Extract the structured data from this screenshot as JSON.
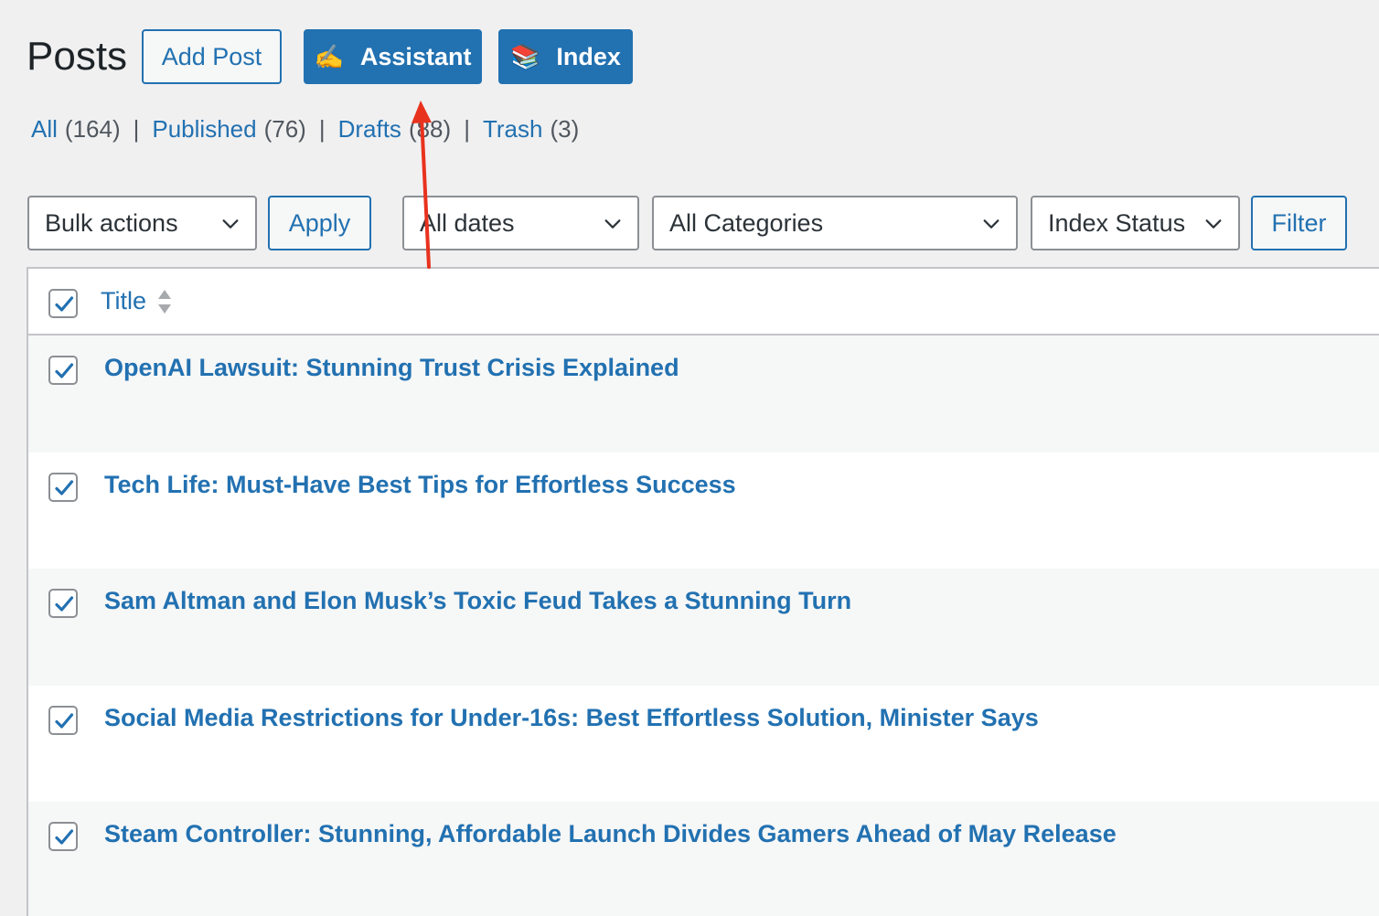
{
  "header": {
    "title": "Posts",
    "add_post": "Add Post",
    "assistant": {
      "emoji": "✍️",
      "label": "Assistant"
    },
    "index": {
      "emoji": "📚",
      "label": "Index"
    }
  },
  "views": [
    {
      "label": "All",
      "count": "(164)"
    },
    {
      "label": "Published",
      "count": "(76)"
    },
    {
      "label": "Drafts",
      "count": "(88)"
    },
    {
      "label": "Trash",
      "count": "(3)"
    }
  ],
  "views_separator": "|",
  "filters": {
    "bulk_actions": "Bulk actions",
    "apply": "Apply",
    "dates": "All dates",
    "categories": "All Categories",
    "index_status": "Index Status",
    "filter": "Filter"
  },
  "table": {
    "column_title": "Title",
    "rows": [
      {
        "title": "OpenAI Lawsuit: Stunning Trust Crisis Explained",
        "checked": true
      },
      {
        "title": "Tech Life: Must-Have Best Tips for Effortless Success",
        "checked": true
      },
      {
        "title": "Sam Altman and Elon Musk’s Toxic Feud Takes a Stunning Turn",
        "checked": true
      },
      {
        "title": "Social Media Restrictions for Under-16s: Best Effortless Solution, Minister Says",
        "checked": true
      },
      {
        "title": "Steam Controller: Stunning, Affordable Launch Divides Gamers Ahead of May Release",
        "checked": true
      }
    ]
  },
  "colors": {
    "accent": "#2271b1",
    "background": "#f0f0f1",
    "annotation_arrow": "#e8321e"
  },
  "icons": [
    "chevron-down-icon",
    "sort-icon",
    "checkbox-checked-icon",
    "annotation-arrow"
  ]
}
